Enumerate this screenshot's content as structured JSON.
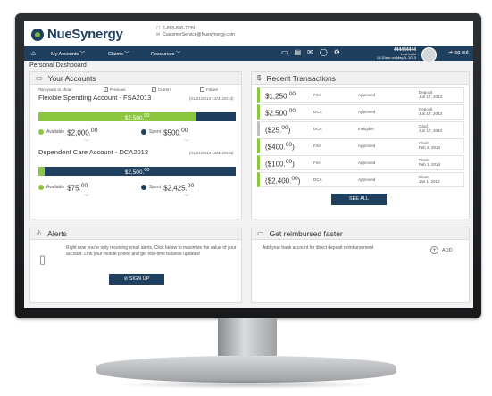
{
  "brand": {
    "name": "NueSynergy",
    "phone": "1-855-890-7239",
    "email": "CustomerService@Nuesynergy.com",
    "primary_color": "#1f3f5e",
    "accent_color": "#8cc63f"
  },
  "nav": {
    "home_icon": "home-icon",
    "my_accounts": "My Accounts",
    "claims": "Claims",
    "resources": "Resources",
    "account_number": "444444444",
    "last_login_label": "Last login",
    "last_login_value": "10:20am on May 3, 2013",
    "logout": "log out"
  },
  "page_title": "Personal Dashboard",
  "accounts": {
    "title": "Your Accounts",
    "plan_years_label": "Plan years to show:",
    "options": [
      {
        "label": "Previous",
        "checked": true
      },
      {
        "label": "Current",
        "checked": true
      },
      {
        "label": "Future",
        "checked": false
      }
    ],
    "items": [
      {
        "name": "Flexible Spending Account - FSA2013",
        "dates": "(01/01/2013-12/31/2013)",
        "balance": "$2,500.",
        "balance_sup": "00",
        "available_fraction": 0.8,
        "available_label": "Available",
        "available_amount": "$2,000.",
        "available_sup": "00",
        "spent_label": "Spent",
        "spent_amount": "$500.",
        "spent_sup": "00"
      },
      {
        "name": "Dependent Care Account - DCA2013",
        "dates": "(01/01/2013-12/31/2013)",
        "balance": "$2,500.",
        "balance_sup": "00",
        "available_fraction": 0.03,
        "available_label": "Available",
        "available_amount": "$75.",
        "available_sup": "00",
        "spent_label": "Spent",
        "spent_amount": "$2,425.",
        "spent_sup": "00"
      }
    ]
  },
  "transactions": {
    "title": "Recent Transactions",
    "rows": [
      {
        "amount": "$1,250.",
        "sup": "00",
        "type": "FSA",
        "status": "Approved",
        "kind": "Deposit",
        "date": "Jun 17, 2013",
        "accent": "green"
      },
      {
        "amount": "$2,500.",
        "sup": "00",
        "type": "DCA",
        "status": "Approved",
        "kind": "Deposit",
        "date": "Jun 17, 2013",
        "accent": "green"
      },
      {
        "amount": "($25.",
        "sup": "00",
        "close": ")",
        "type": "DCA",
        "status": "Ineligible",
        "kind": "Card",
        "date": "Jun 17, 2013",
        "accent": "gray"
      },
      {
        "amount": "($400.",
        "sup": "00",
        "close": ")",
        "type": "FSA",
        "status": "Approved",
        "kind": "Claim",
        "date": "Feb 2, 2013",
        "accent": "green"
      },
      {
        "amount": "($100.",
        "sup": "00",
        "close": ")",
        "type": "FSA",
        "status": "Approved",
        "kind": "Claim",
        "date": "Feb 1, 2013",
        "accent": "green"
      },
      {
        "amount": "($2,400.",
        "sup": "00",
        "close": ")",
        "type": "DCA",
        "status": "Approved",
        "kind": "Claim",
        "date": "Jan 1, 2013",
        "accent": "green"
      }
    ],
    "see_all": "SEE ALL"
  },
  "alerts": {
    "title": "Alerts",
    "text": "Right now you're only receiving email alerts. Click below to maximize the value of your account. Link your mobile phone and get real-time balance updates!",
    "signup": "SIGN UP"
  },
  "reimburse": {
    "title": "Get reimbursed faster",
    "text": "Add your bank account for direct deposit reimbursement",
    "add": "ADD"
  }
}
